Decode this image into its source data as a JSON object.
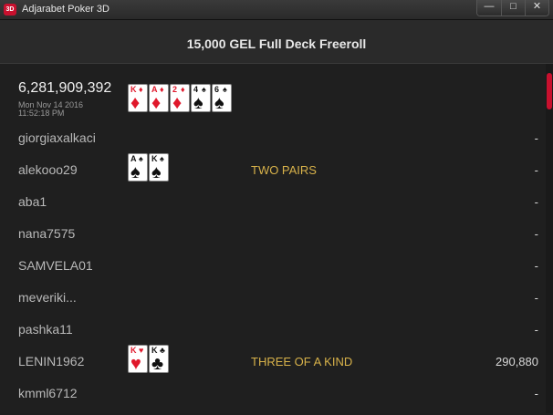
{
  "window": {
    "icon_text": "3D",
    "title": "Adjarabet Poker 3D",
    "buttons": {
      "minimize": "—",
      "maximize": "□",
      "close": "✕"
    }
  },
  "tournament": {
    "title": "15,000 GEL Full Deck Freeroll"
  },
  "hand": {
    "id": "6,281,909,392",
    "date": "Mon Nov 14 2016",
    "time": "11:52:18 PM",
    "board": [
      {
        "rank": "K",
        "suit": "♦",
        "color": "red"
      },
      {
        "rank": "A",
        "suit": "♦",
        "color": "red"
      },
      {
        "rank": "2",
        "suit": "♦",
        "color": "red"
      },
      {
        "rank": "4",
        "suit": "♠",
        "color": "black"
      },
      {
        "rank": "6",
        "suit": "♠",
        "color": "black"
      }
    ]
  },
  "players": [
    {
      "name": "giorgiaxalkaci",
      "cards": [],
      "hand_rank": "",
      "winnings": "-"
    },
    {
      "name": "alekooo29",
      "cards": [
        {
          "rank": "A",
          "suit": "♠",
          "color": "black"
        },
        {
          "rank": "K",
          "suit": "♠",
          "color": "black"
        }
      ],
      "hand_rank": "TWO PAIRS",
      "winnings": "-"
    },
    {
      "name": "aba1",
      "cards": [],
      "hand_rank": "",
      "winnings": "-"
    },
    {
      "name": "nana7575",
      "cards": [],
      "hand_rank": "",
      "winnings": "-"
    },
    {
      "name": "SAMVELA01",
      "cards": [],
      "hand_rank": "",
      "winnings": "-"
    },
    {
      "name": "meveriki...",
      "cards": [],
      "hand_rank": "",
      "winnings": "-"
    },
    {
      "name": "pashka11",
      "cards": [],
      "hand_rank": "",
      "winnings": "-"
    },
    {
      "name": "LENIN1962",
      "cards": [
        {
          "rank": "K",
          "suit": "♥",
          "color": "red"
        },
        {
          "rank": "K",
          "suit": "♣",
          "color": "black"
        }
      ],
      "hand_rank": "THREE OF A KIND",
      "winnings": "290,880"
    },
    {
      "name": "kmml6712",
      "cards": [],
      "hand_rank": "",
      "winnings": "-"
    }
  ]
}
